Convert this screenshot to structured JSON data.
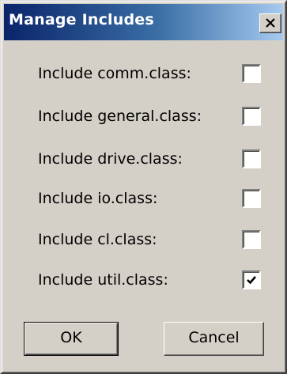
{
  "window": {
    "title": "Manage Includes",
    "close_icon": "close-x-icon"
  },
  "includes": [
    {
      "label": "Include comm.class:",
      "checked": false
    },
    {
      "label": "Include general.class:",
      "checked": false
    },
    {
      "label": "Include drive.class:",
      "checked": false
    },
    {
      "label": "Include io.class:",
      "checked": false
    },
    {
      "label": "Include cl.class:",
      "checked": false
    },
    {
      "label": "Include util.class:",
      "checked": true
    }
  ],
  "buttons": {
    "ok_label": "OK",
    "cancel_label": "Cancel"
  },
  "colors": {
    "dialog_face": "#d4d0c8",
    "titlebar_start": "#0a246a",
    "titlebar_end": "#a6caf0",
    "title_text": "#ffffff"
  }
}
